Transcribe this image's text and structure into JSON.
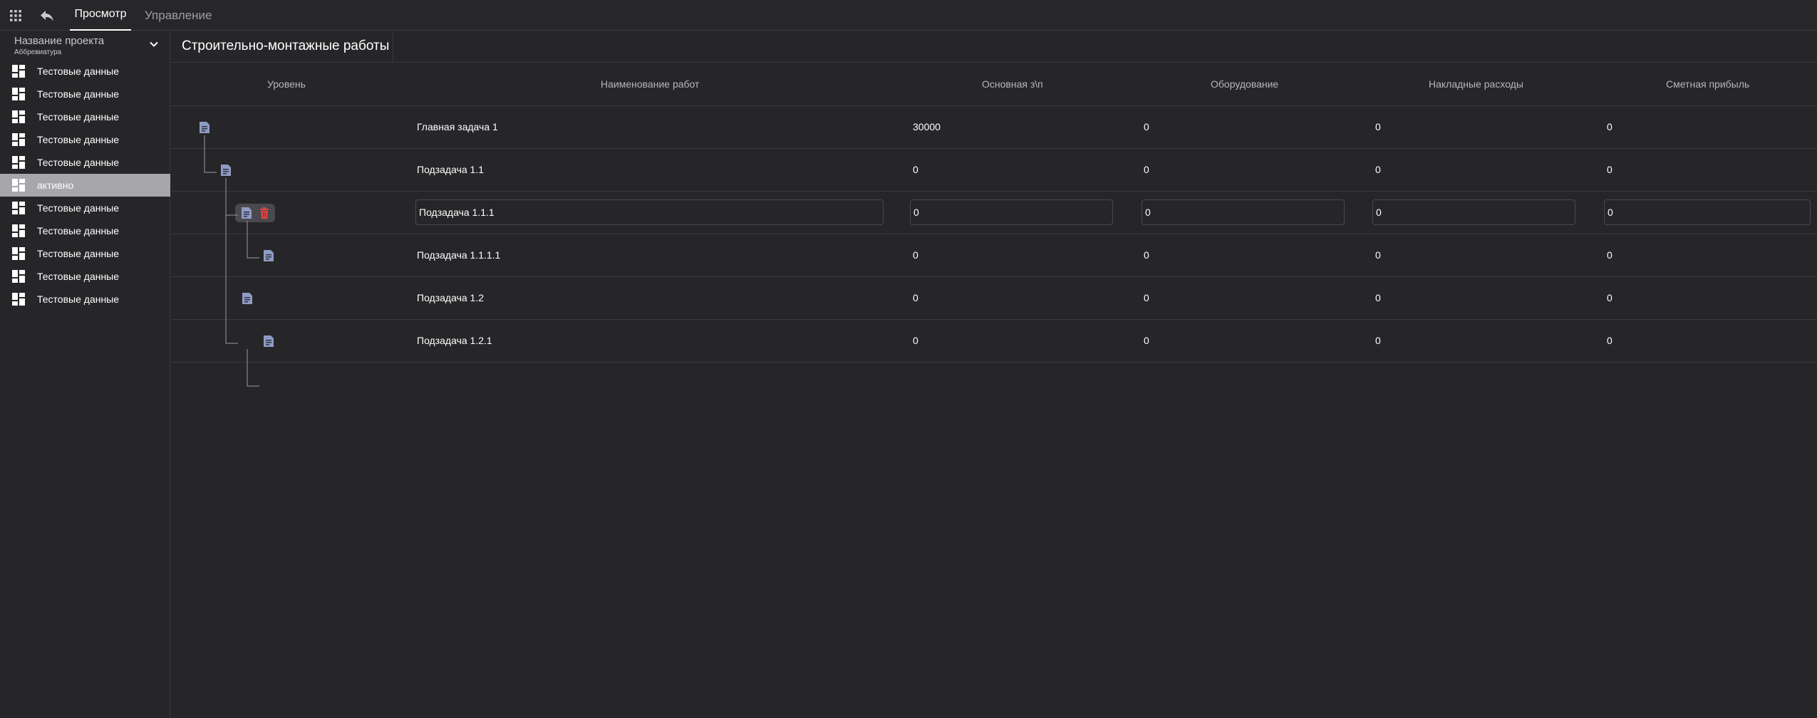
{
  "header": {
    "tabs": [
      {
        "label": "Просмотр",
        "active": true
      },
      {
        "label": "Управление",
        "active": false
      }
    ]
  },
  "sidebar": {
    "project_name": "Название проекта",
    "project_abbr": "Аббревиатура",
    "items": [
      {
        "label": "Тестовые данные",
        "active": false
      },
      {
        "label": "Тестовые данные",
        "active": false
      },
      {
        "label": "Тестовые данные",
        "active": false
      },
      {
        "label": "Тестовые данные",
        "active": false
      },
      {
        "label": "Тестовые данные",
        "active": false
      },
      {
        "label": "активно",
        "active": true
      },
      {
        "label": "Тестовые данные",
        "active": false
      },
      {
        "label": "Тестовые данные",
        "active": false
      },
      {
        "label": "Тестовые данные",
        "active": false
      },
      {
        "label": "Тестовые данные",
        "active": false
      },
      {
        "label": "Тестовые данные",
        "active": false
      }
    ]
  },
  "main": {
    "title": "Строительно-монтажные работы",
    "columns": [
      "Уровень",
      "Наименование работ",
      "Основная з\\п",
      "Оборудование",
      "Накладные расходы",
      "Сметная прибыль"
    ],
    "rows": [
      {
        "name": "Главная задача 1",
        "salary": "30000",
        "equipment": "0",
        "overhead": "0",
        "profit": "0",
        "level": 0,
        "editing": false
      },
      {
        "name": "Подзадача 1.1",
        "salary": "0",
        "equipment": "0",
        "overhead": "0",
        "profit": "0",
        "level": 1,
        "editing": false
      },
      {
        "name": "Подзадача 1.1.1",
        "salary": "0",
        "equipment": "0",
        "overhead": "0",
        "profit": "0",
        "level": 2,
        "editing": true
      },
      {
        "name": "Подзадача 1.1.1.1",
        "salary": "0",
        "equipment": "0",
        "overhead": "0",
        "profit": "0",
        "level": 3,
        "editing": false
      },
      {
        "name": "Подзадача 1.2",
        "salary": "0",
        "equipment": "0",
        "overhead": "0",
        "profit": "0",
        "level": 2,
        "editing": false
      },
      {
        "name": "Подзадача 1.2.1",
        "salary": "0",
        "equipment": "0",
        "overhead": "0",
        "profit": "0",
        "level": 3,
        "editing": false
      }
    ]
  },
  "icons": {
    "apps": "apps-grid-icon",
    "back": "reply-arrow-icon",
    "project_toggle": "chevron-down-icon",
    "sidebar_item": "dashboard-icon",
    "row": "document-icon",
    "delete": "trash-icon"
  },
  "colors": {
    "background": "#262629",
    "active_sidebar": "#a7a7ab",
    "row_icon": "#8e9bc4",
    "delete_icon": "#e04646",
    "divider": "#3a3a3e"
  }
}
